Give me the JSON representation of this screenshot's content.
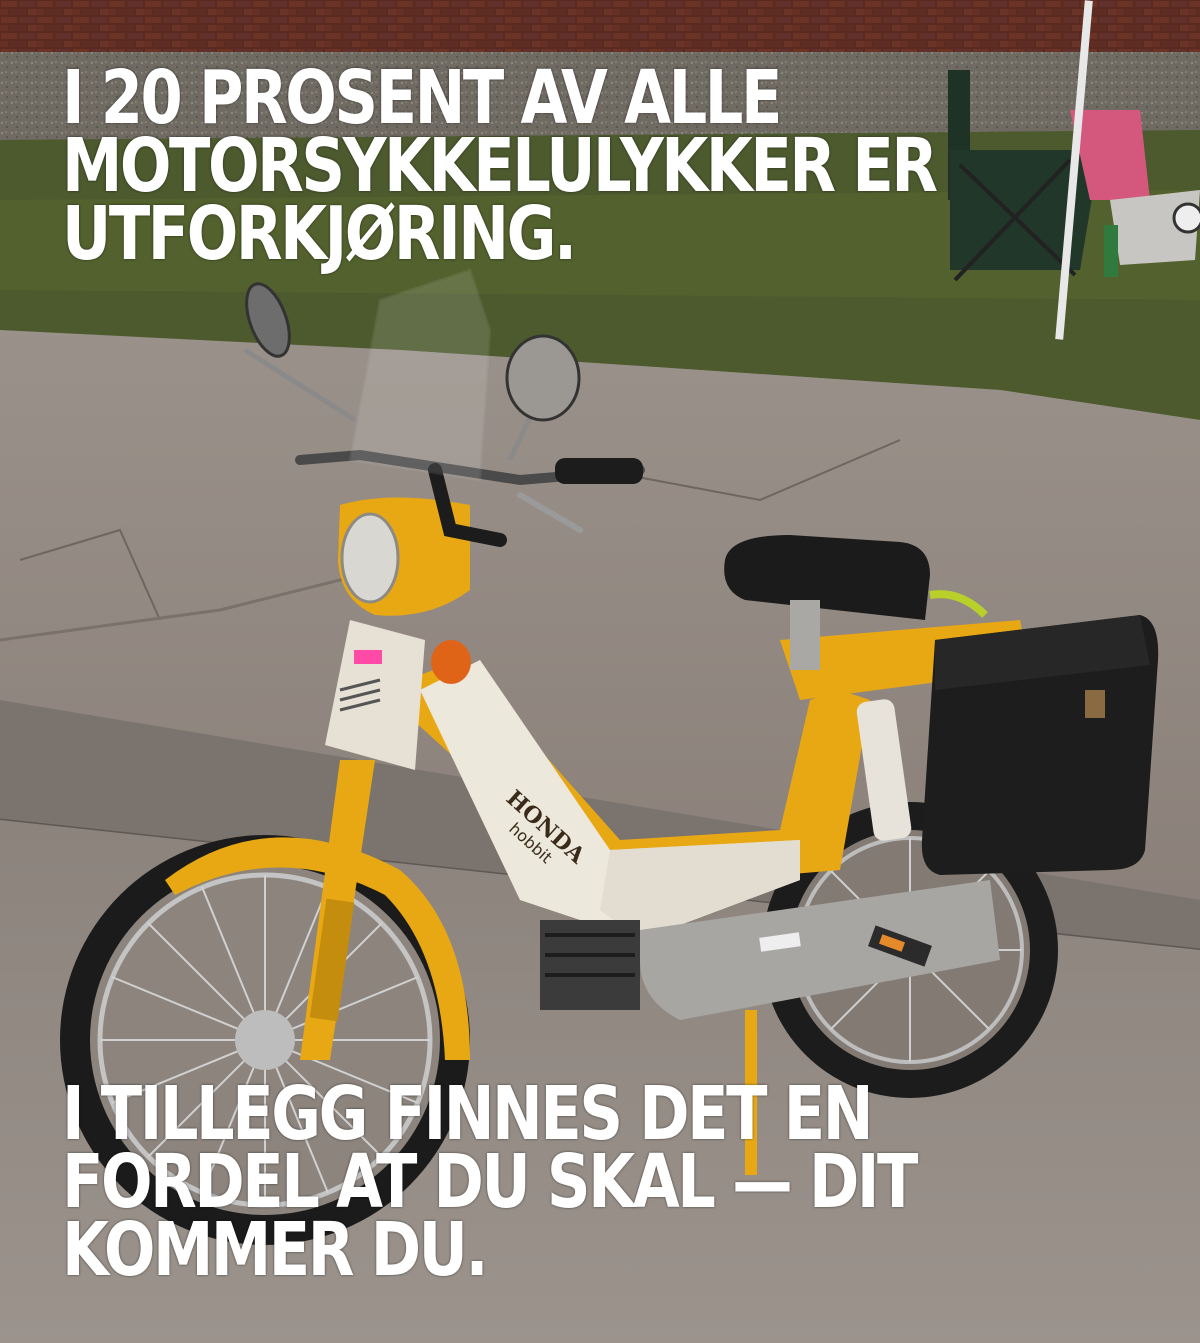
{
  "meme": {
    "top_lines": [
      "I 20 PROSENT AV ALLE",
      "MOTORSYKKELULYKKER ER",
      "UTFORKJØRING."
    ],
    "bottom_lines": [
      "I TILLEGG FINNES DET EN",
      "FORDEL AT DU SKAL — DIT",
      "KOMMER DU."
    ],
    "text_color": "#ffffff"
  },
  "scene": {
    "vehicle_color": "#e8a814",
    "brand_badge": "HONDA",
    "model_badge": "hobbit"
  }
}
